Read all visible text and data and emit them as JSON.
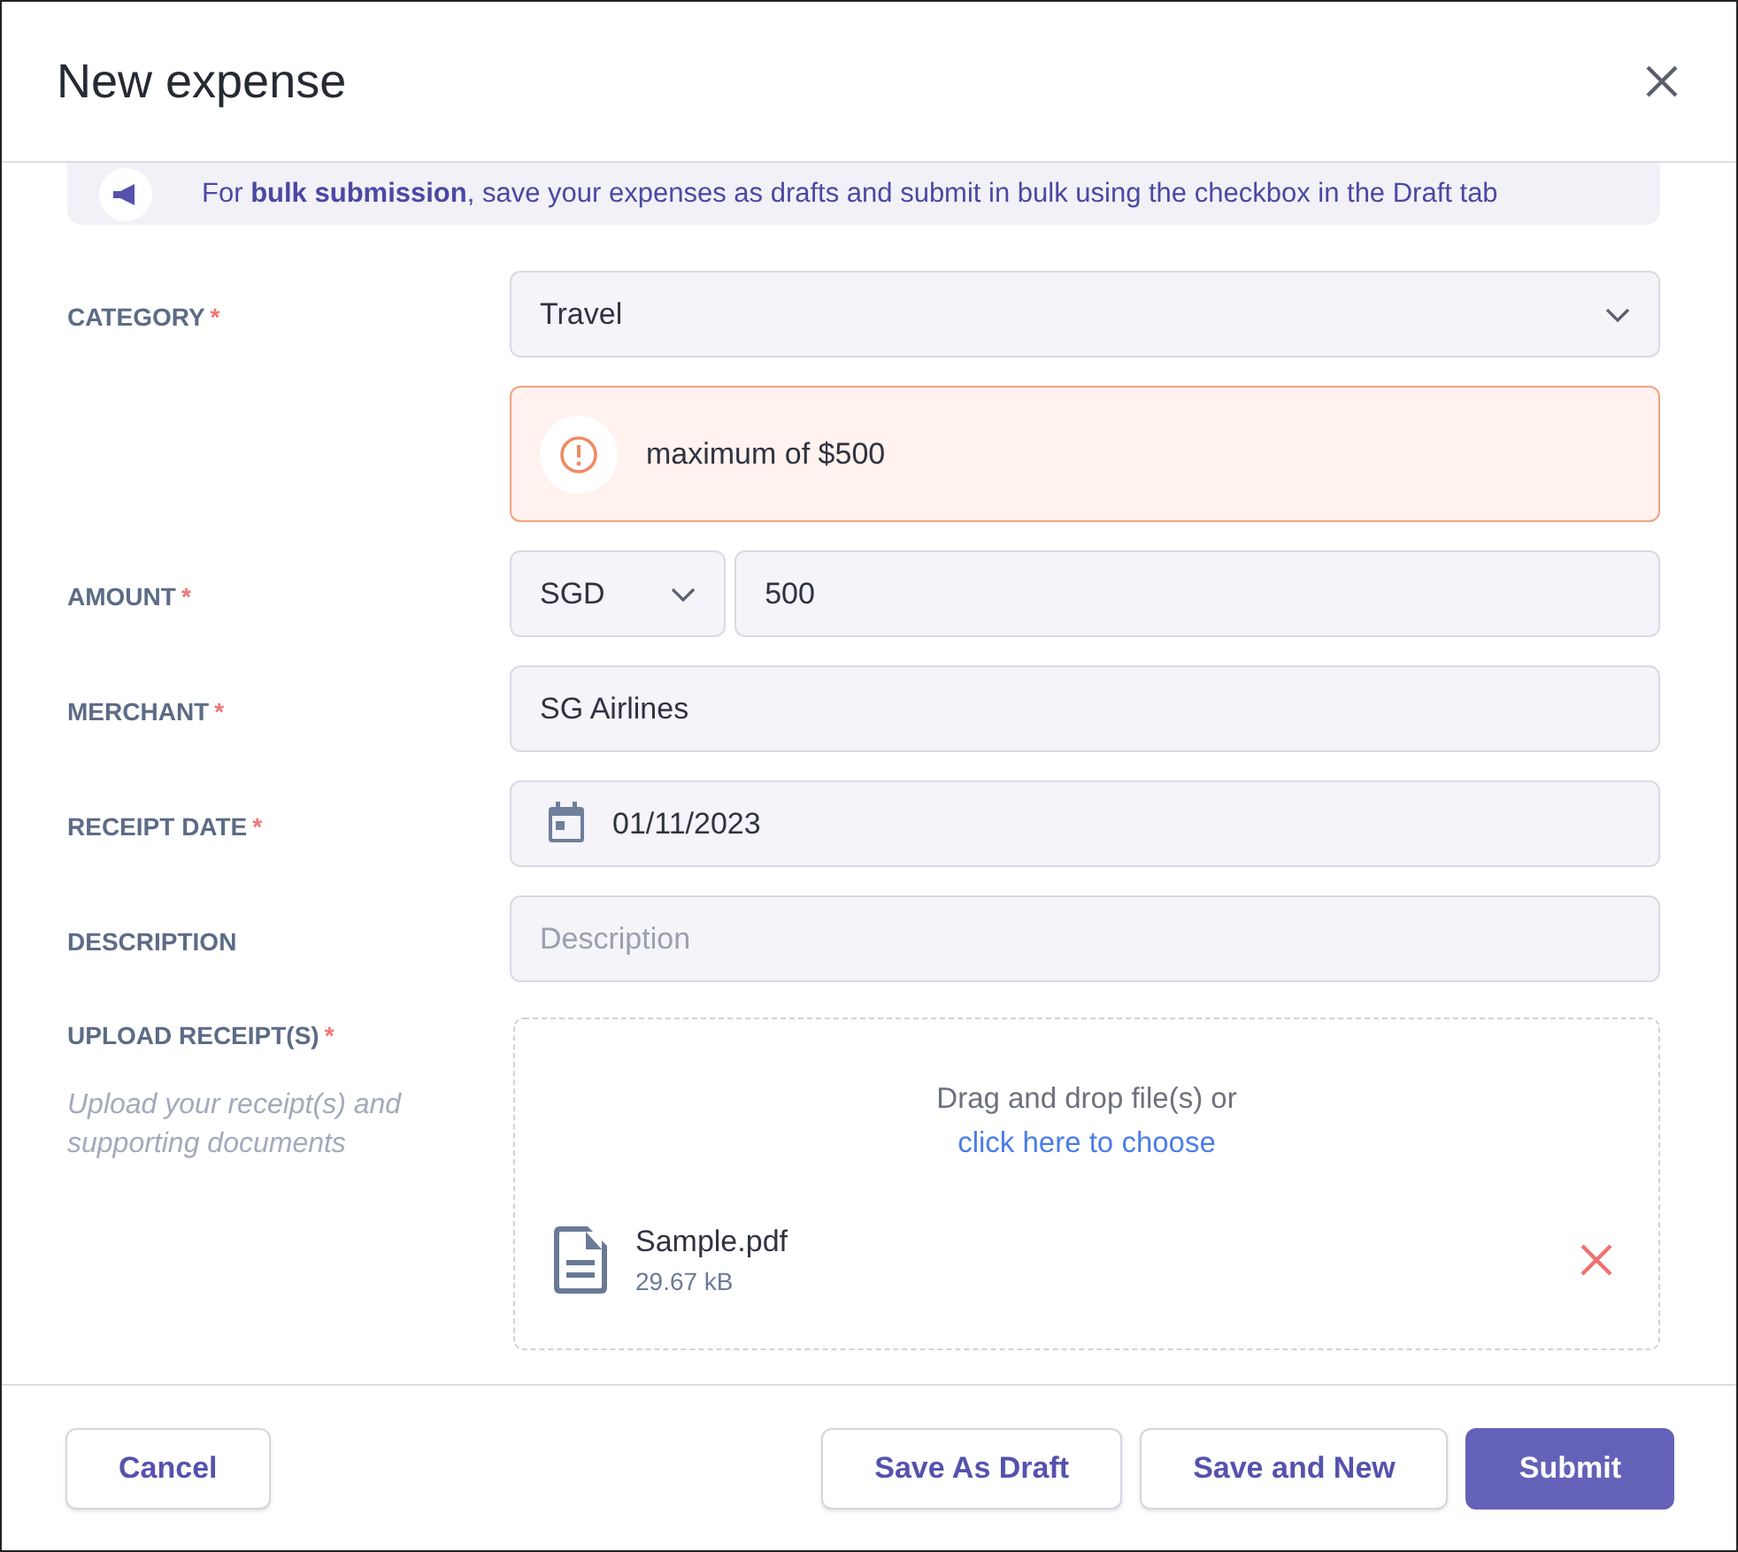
{
  "modal": {
    "title": "New expense"
  },
  "banner": {
    "text": "For **bulk submission**, save your expenses as drafts and submit in bulk using the checkbox in the Draft tab"
  },
  "fields": [
    {
      "kind": "select",
      "label": "CATEGORY",
      "required_mark": "*",
      "value": "Travel",
      "warning": "maximum of $500"
    },
    {
      "kind": "amount",
      "label": "AMOUNT",
      "required_mark": "*",
      "currency": "SGD",
      "value": "500"
    },
    {
      "kind": "text",
      "label": "MERCHANT",
      "required_mark": "*",
      "value": "SG Airlines"
    },
    {
      "kind": "date",
      "label": "RECEIPT DATE",
      "required_mark": "*",
      "value": "01/11/2023"
    },
    {
      "kind": "text",
      "label": "DESCRIPTION",
      "placeholder": "Description"
    },
    {
      "kind": "upload",
      "label": "UPLOAD RECEIPT(S)",
      "required_mark": "*",
      "hint": "Upload your receipt(s) and supporting documents",
      "drop_text": "Drag and drop file(s) or",
      "choose_link": "click here to choose",
      "files": [
        {
          "name": "Sample.pdf",
          "size": "29.67 kB"
        }
      ]
    }
  ],
  "buttons": [
    {
      "label": "Cancel",
      "kind": "secondary"
    },
    {
      "label": "Save As Draft",
      "kind": "secondary"
    },
    {
      "label": "Save and New",
      "kind": "secondary"
    },
    {
      "label": "Submit",
      "kind": "primary"
    }
  ]
}
